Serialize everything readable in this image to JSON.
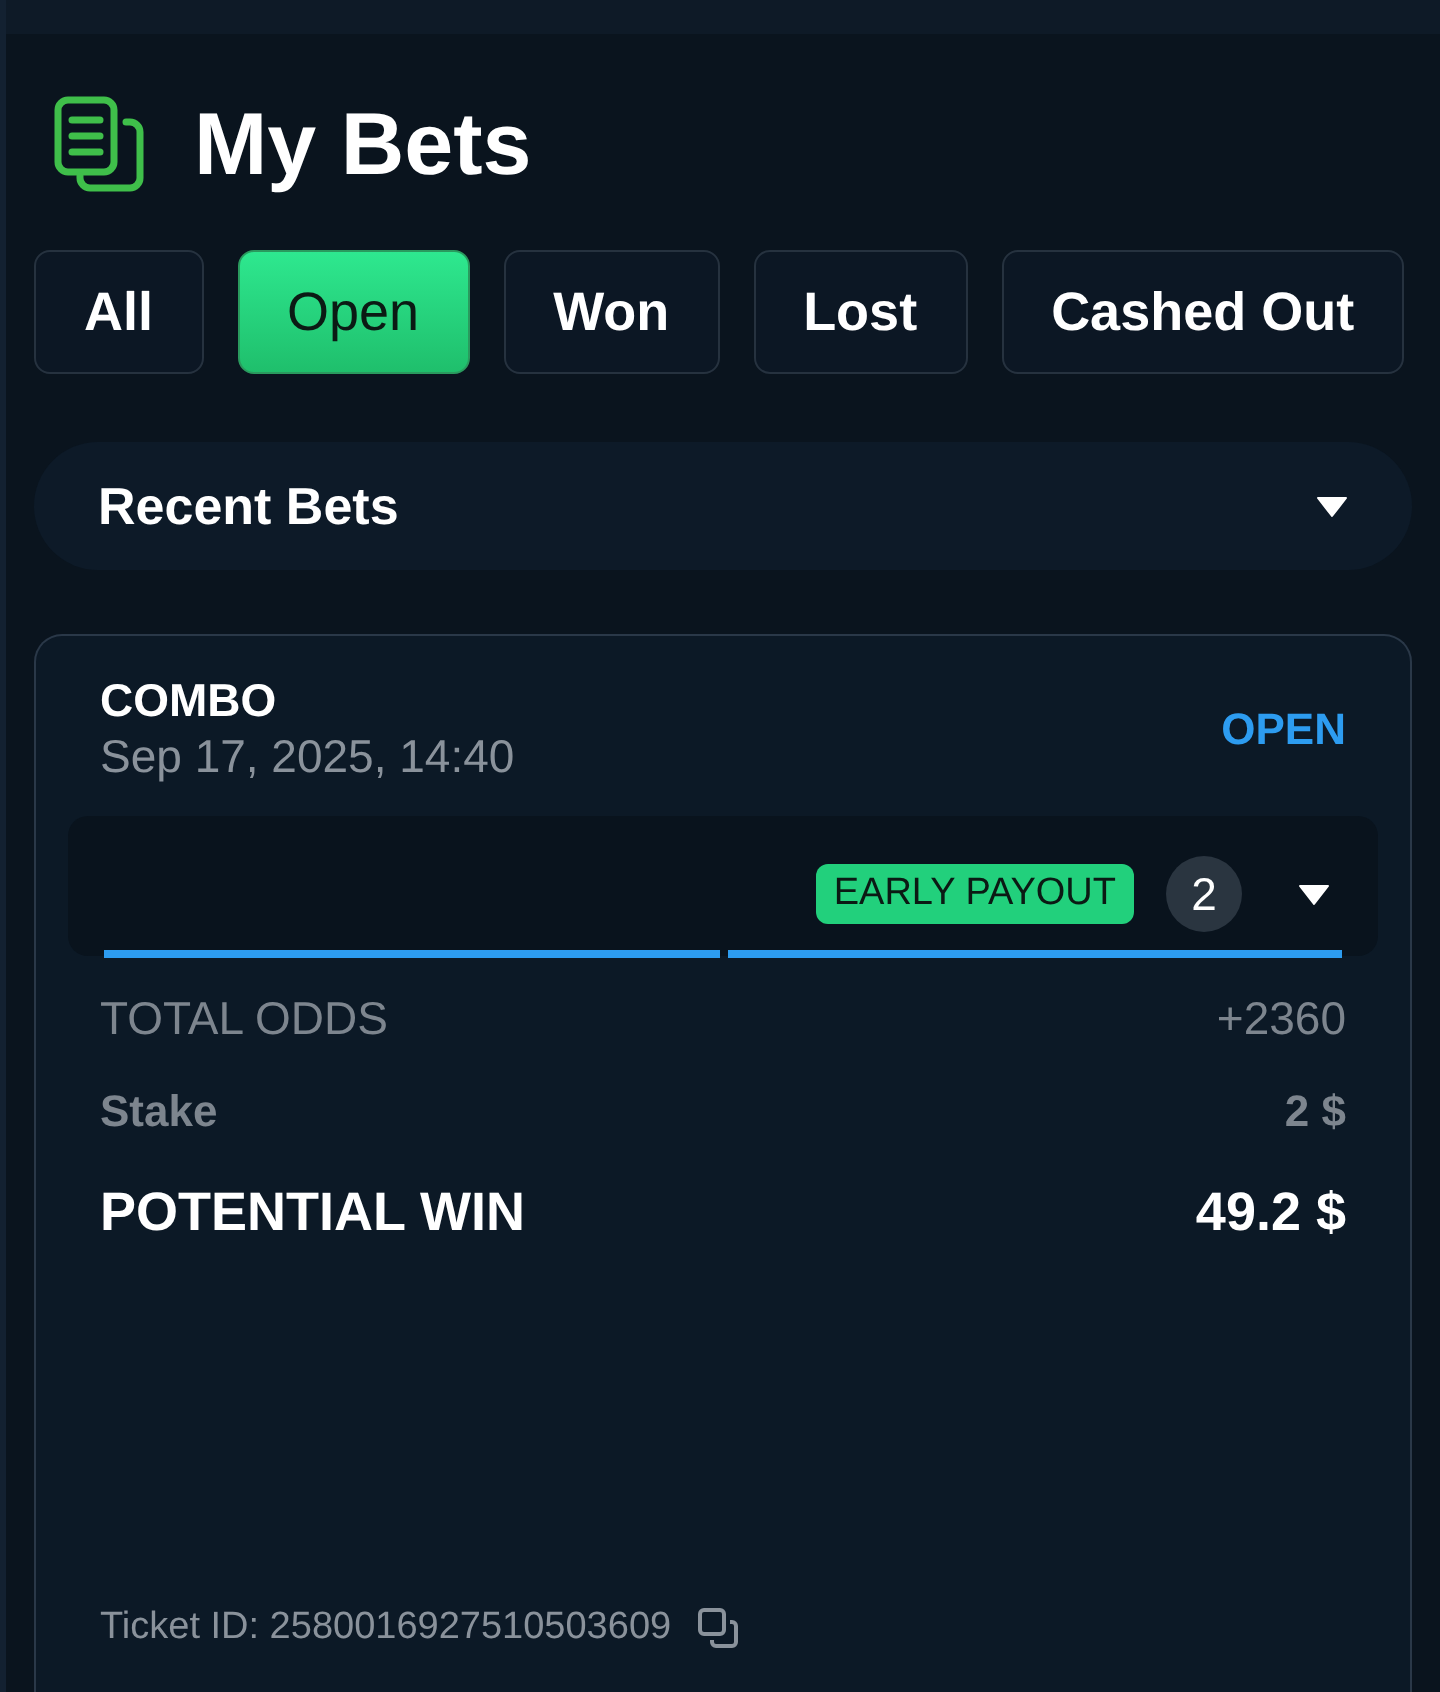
{
  "title": "My Bets",
  "tabs": [
    {
      "label": "All",
      "selected": false
    },
    {
      "label": "Open",
      "selected": true
    },
    {
      "label": "Won",
      "selected": false
    },
    {
      "label": "Lost",
      "selected": false
    },
    {
      "label": "Cashed Out",
      "selected": false
    }
  ],
  "filter": {
    "label": "Recent Bets"
  },
  "bet": {
    "type": "COMBO",
    "date": "Sep 17, 2025, 14:40",
    "status": "OPEN",
    "badge": "EARLY PAYOUT",
    "legs_count": "2",
    "rows": [
      {
        "kind": "muted",
        "label": "TOTAL ODDS",
        "value": "+2360"
      },
      {
        "kind": "muted",
        "label": "Stake",
        "value": "2 $"
      },
      {
        "kind": "strong",
        "label": "POTENTIAL WIN",
        "value": "49.2 $"
      }
    ],
    "ticket": "Ticket ID: 2580016927510503609"
  }
}
